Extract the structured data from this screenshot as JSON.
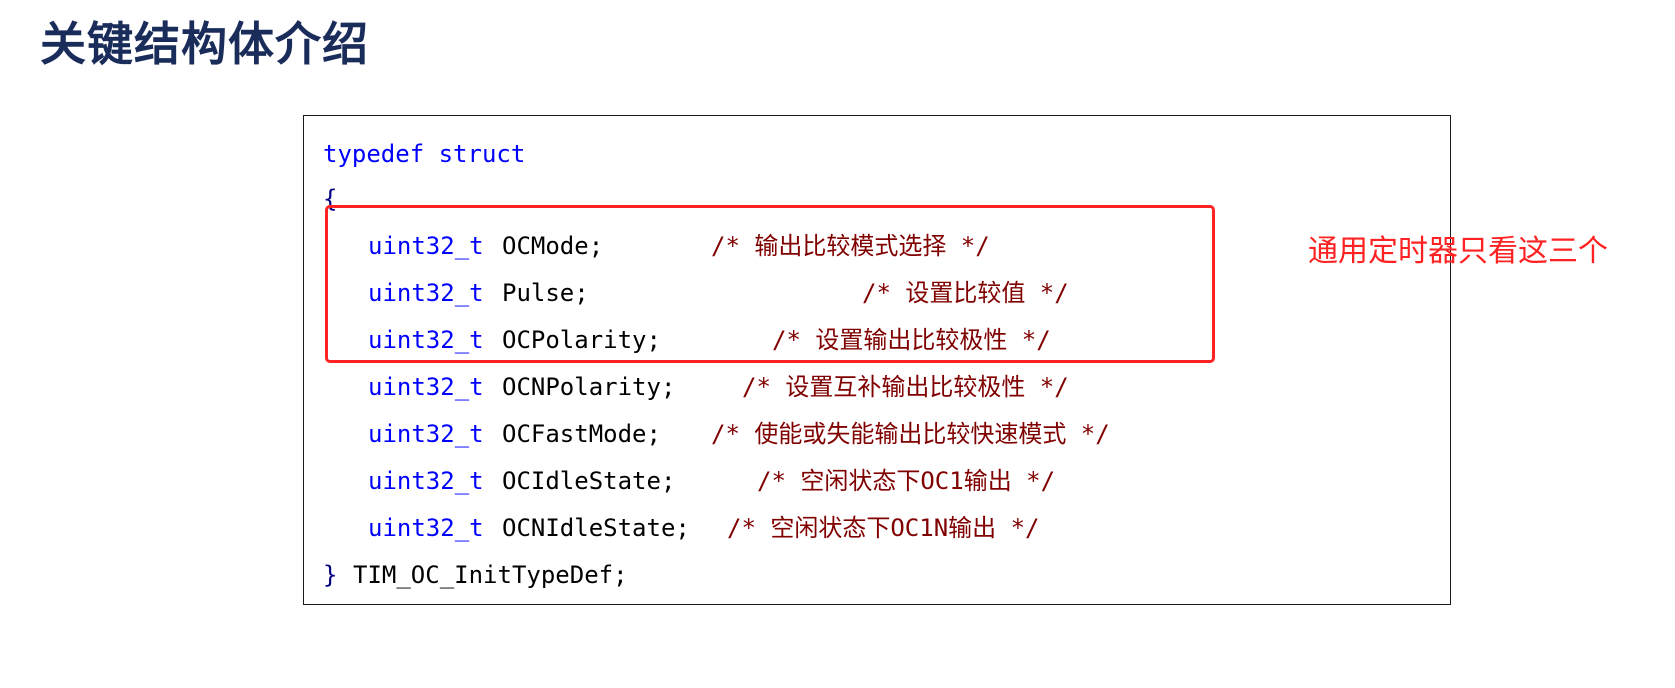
{
  "page": {
    "title": "关键结构体介绍",
    "annotation": "通用定时器只看这三个"
  },
  "colors": {
    "title": "#1a2d5a",
    "keyword": "#0000ff",
    "comment": "#800000",
    "highlight": "#ff2222"
  },
  "code": {
    "open": "typedef struct",
    "open_brace": "{",
    "fields": [
      {
        "type": "uint32_t",
        "name": "OCMode;",
        "comment": "/* 输出比较模式选择 */"
      },
      {
        "type": "uint32_t",
        "name": "Pulse;",
        "comment": "/* 设置比较值 */"
      },
      {
        "type": "uint32_t",
        "name": "OCPolarity;",
        "comment": "/* 设置输出比较极性 */"
      },
      {
        "type": "uint32_t",
        "name": "OCNPolarity;",
        "comment": "/* 设置互补输出比较极性 */"
      },
      {
        "type": "uint32_t",
        "name": "OCFastMode;",
        "comment": "/* 使能或失能输出比较快速模式 */"
      },
      {
        "type": "uint32_t",
        "name": "OCIdleState;",
        "comment": "/* 空闲状态下OC1输出 */"
      },
      {
        "type": "uint32_t",
        "name": "OCNIdleState;",
        "comment": "/* 空闲状态下OC1N输出 */"
      }
    ],
    "close_brace": "}",
    "typedef_name": "TIM_OC_InitTypeDef;"
  }
}
